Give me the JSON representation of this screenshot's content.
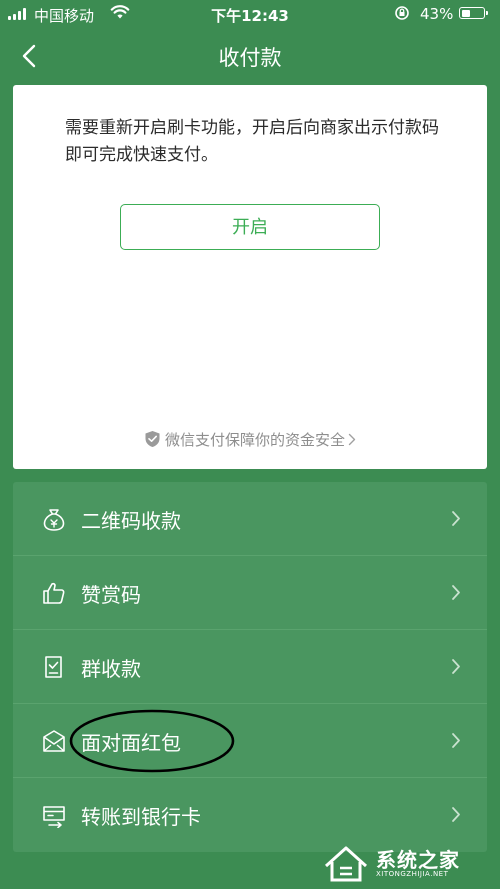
{
  "status_bar": {
    "carrier": "中国移动",
    "time": "下午12:43",
    "battery_percent": "43%",
    "battery_level": 0.43
  },
  "nav": {
    "title": "收付款",
    "back_icon": "chevron-left-icon"
  },
  "card": {
    "message": "需要重新开启刷卡功能，开启后向商家出示付款码即可完成快速支付。",
    "open_button": "开启",
    "accent": "#3cad55",
    "security_text": "微信支付保障你的资金安全",
    "security_icon": "shield-icon"
  },
  "menu": {
    "items": [
      {
        "label": "二维码收款",
        "icon": "money-bag-icon"
      },
      {
        "label": "赞赏码",
        "icon": "thumbs-up-icon"
      },
      {
        "label": "群收款",
        "icon": "document-check-icon"
      },
      {
        "label": "面对面红包",
        "icon": "red-envelope-icon"
      },
      {
        "label": "转账到银行卡",
        "icon": "bank-card-transfer-icon"
      }
    ]
  },
  "watermark": {
    "text": "系统之家",
    "subtext": "XITONGZHIJIA.NET"
  },
  "colors": {
    "background": "#3c8c52",
    "menu_background": "#4a9660"
  }
}
